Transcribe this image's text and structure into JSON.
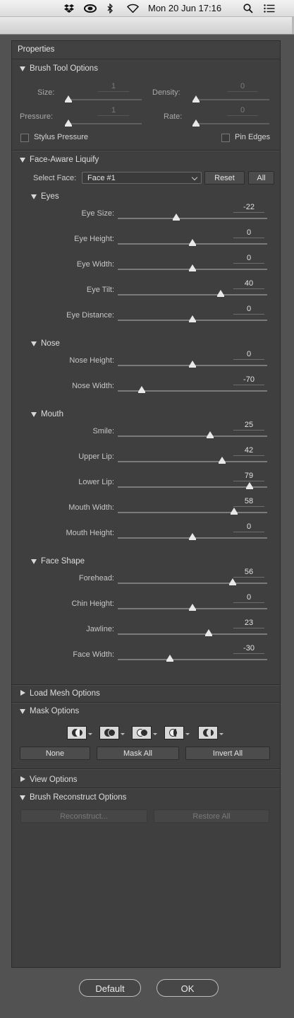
{
  "menubar": {
    "datetime": "Mon 20 Jun  17:16"
  },
  "panel": {
    "title": "Properties"
  },
  "brush_tool_options": {
    "title": "Brush Tool Options",
    "size": {
      "label": "Size:",
      "value": "1",
      "level": 0
    },
    "density": {
      "label": "Density:",
      "value": "0",
      "level": 0
    },
    "pressure": {
      "label": "Pressure:",
      "value": "1",
      "level": 0
    },
    "rate": {
      "label": "Rate:",
      "value": "0",
      "level": 0
    },
    "stylus_pressure": "Stylus Pressure",
    "pin_edges": "Pin Edges"
  },
  "face_aware": {
    "title": "Face-Aware Liquify",
    "select_face_label": "Select Face:",
    "select_face_value": "Face #1",
    "reset_label": "Reset",
    "all_label": "All",
    "eyes": {
      "title": "Eyes",
      "sliders": [
        {
          "label": "Eye Size:",
          "value": "-22",
          "pos": 0.39
        },
        {
          "label": "Eye Height:",
          "value": "0",
          "pos": 0.5
        },
        {
          "label": "Eye Width:",
          "value": "0",
          "pos": 0.5
        },
        {
          "label": "Eye Tilt:",
          "value": "40",
          "pos": 0.69
        },
        {
          "label": "Eye Distance:",
          "value": "0",
          "pos": 0.5
        }
      ]
    },
    "nose": {
      "title": "Nose",
      "sliders": [
        {
          "label": "Nose Height:",
          "value": "0",
          "pos": 0.5
        },
        {
          "label": "Nose Width:",
          "value": "-70",
          "pos": 0.16
        }
      ]
    },
    "mouth": {
      "title": "Mouth",
      "sliders": [
        {
          "label": "Smile:",
          "value": "25",
          "pos": 0.62
        },
        {
          "label": "Upper Lip:",
          "value": "42",
          "pos": 0.7
        },
        {
          "label": "Lower Lip:",
          "value": "79",
          "pos": 0.88
        },
        {
          "label": "Mouth Width:",
          "value": "58",
          "pos": 0.78
        },
        {
          "label": "Mouth Height:",
          "value": "0",
          "pos": 0.5
        }
      ]
    },
    "face_shape": {
      "title": "Face Shape",
      "sliders": [
        {
          "label": "Forehead:",
          "value": "56",
          "pos": 0.77
        },
        {
          "label": "Chin Height:",
          "value": "0",
          "pos": 0.5
        },
        {
          "label": "Jawline:",
          "value": "23",
          "pos": 0.61
        },
        {
          "label": "Face Width:",
          "value": "-30",
          "pos": 0.35
        }
      ]
    }
  },
  "load_mesh_options": {
    "title": "Load Mesh Options"
  },
  "mask_options": {
    "title": "Mask Options",
    "modes": [
      "replace-selection-icon",
      "add-to-selection-icon",
      "subtract-from-selection-icon",
      "intersect-with-selection-icon",
      "invert-selection-icon"
    ],
    "none_label": "None",
    "mask_all_label": "Mask All",
    "invert_all_label": "Invert All"
  },
  "view_options": {
    "title": "View Options"
  },
  "brush_reconstruct_options": {
    "title": "Brush Reconstruct Options",
    "reconstruct_label": "Reconstruct...",
    "restore_all_label": "Restore All"
  },
  "footer": {
    "default_label": "Default",
    "ok_label": "OK"
  }
}
